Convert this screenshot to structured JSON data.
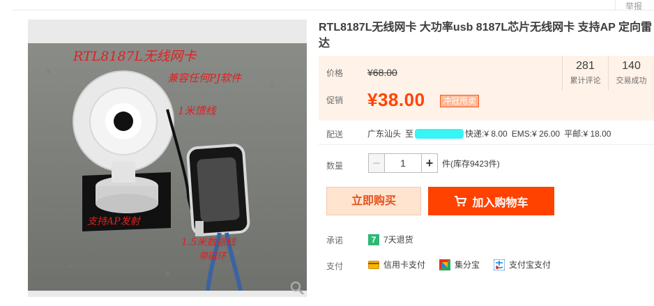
{
  "header": {
    "report_label": "举报"
  },
  "product": {
    "title": "RTL8187L无线网卡 大功率usb 8187L芯片无线网卡 支持AP 定向雷达",
    "photo_texts": {
      "model": "RTL8187L无线网卡",
      "support": "兼容任何PJ软件",
      "cable1": "1米馈线",
      "ap": "支持AP发射",
      "usb": "1.5米数据线",
      "usb2": "带磁环"
    }
  },
  "price": {
    "label": "价格",
    "original": "¥68.00",
    "promo_label": "促销",
    "promo": "¥38.00",
    "promo_badge": "冲冠甩卖"
  },
  "stats": [
    {
      "num": "281",
      "label": "累计评论"
    },
    {
      "num": "140",
      "label": "交易成功"
    }
  ],
  "delivery": {
    "label": "配送",
    "from": "广东汕头",
    "to_label": "至",
    "express": "快递:¥ 8.00",
    "ems": "EMS:¥ 26.00",
    "post": "平邮:¥ 18.00"
  },
  "quantity": {
    "label": "数量",
    "minus": "−",
    "value": "1",
    "plus": "+",
    "unit_stock": "件(库存9423件)"
  },
  "actions": {
    "buy_now": "立即购买",
    "add_cart": "加入购物车"
  },
  "promise": {
    "label": "承诺",
    "icon_text": "7",
    "text": "7天退货"
  },
  "payment": {
    "label": "支付",
    "methods": [
      {
        "name": "信用卡支付",
        "icon": "credit-card-icon"
      },
      {
        "name": "集分宝",
        "icon": "jifenbao-icon"
      },
      {
        "name": "支付宝支付",
        "icon": "alipay-icon"
      }
    ]
  },
  "colors": {
    "accent": "#ff4400",
    "price_box": "#fff2e8",
    "buy_now_bg": "#ffe4d0",
    "promise_icon": "#2fb877"
  }
}
